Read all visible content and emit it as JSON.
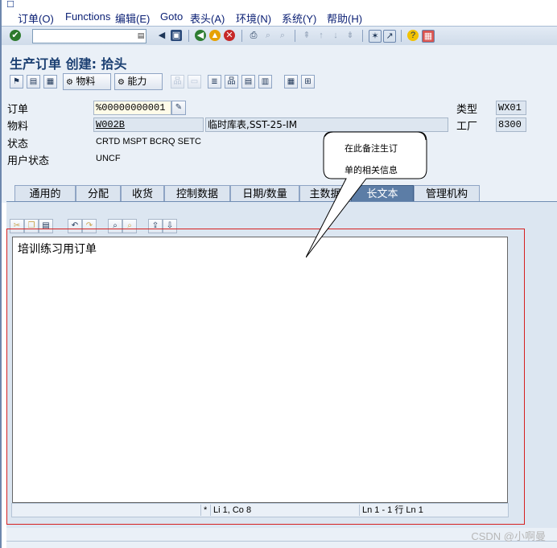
{
  "menubar": {
    "items": [
      "订单(O)",
      "Functions",
      "编辑(E)",
      "Goto",
      "表头(A)",
      "环境(N)",
      "系统(Y)",
      "帮助(H)"
    ]
  },
  "title": "生产订单 创建: 拾头",
  "apptoolbar": {
    "material_button": "物料",
    "capacity_button": "能力"
  },
  "header": {
    "order_label": "订单",
    "order_value": "%00000000001",
    "material_label": "物料",
    "material_value": "W002B",
    "material_desc": "临时库表,SST-25-IM",
    "status_label": "状态",
    "status_value": "CRTD MSPT BCRQ SETC",
    "user_status_label": "用户状态",
    "user_status_value": "UNCF",
    "type_label": "类型",
    "type_value": "WX01",
    "plant_label": "工厂",
    "plant_value": "8300"
  },
  "tabs": [
    "通用的",
    "分配",
    "收货",
    "控制数据",
    "日期/数量",
    "主数据",
    "长文本",
    "管理机构"
  ],
  "active_tab": "长文本",
  "editor": {
    "text": "培训练习用订单",
    "status_left": "*",
    "status_pos": "Li 1, Co 8",
    "status_lines": "Ln 1 - 1 行 Ln 1"
  },
  "callout": {
    "line1": "在此备注生订",
    "line2": "单的相关信息"
  },
  "watermark": "CSDN @小啊曼"
}
